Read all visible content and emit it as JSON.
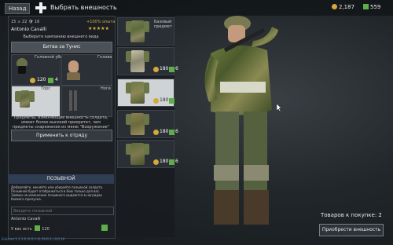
{
  "topbar": {
    "back_label": "Назад",
    "title": "Выбрать внешность",
    "coins": "2,187",
    "gold": "559"
  },
  "profile": {
    "stats": "15 ⚔ 22 🛡 16",
    "exp_bonus": "+100% опыта",
    "name": "Antonio Cavalli",
    "rating": "★★★★★"
  },
  "campaign_select": {
    "prompt": "Выберите кампанию внешнего вида",
    "button_label": "Битва за Тунис"
  },
  "slots": {
    "helmet": {
      "label": "Головной убор",
      "price": "120",
      "count": "4"
    },
    "head": {
      "label": "Голова"
    },
    "torso": {
      "label": "Торс"
    },
    "legs": {
      "label": "Ноги"
    }
  },
  "info_text": "Предметы, изменяющие внешность солдата, имеют более высокий приоритет, чем предметы снаряжения из меню \"Вооружение\"",
  "apply_button": "Применить к отряду",
  "callsign": {
    "header": "ПОЗЫВНОЙ",
    "description": "Добавляйте, меняйте или убирайте позывной солдата. Позывной будет отображаться в бою только для вас. Заявки на изменение позывного выдаются в наградах боевого пропуска.",
    "placeholder": "Введите позывной",
    "owner": "Antonio Cavalli",
    "have_label": "У вас есть",
    "have_count": "120"
  },
  "items": [
    {
      "label": "Базовый предмет",
      "price": "",
      "count": ""
    },
    {
      "label": "",
      "price": "180",
      "count": "6"
    },
    {
      "label": "",
      "price": "180",
      "count": "6"
    },
    {
      "label": "",
      "price": "180",
      "count": "6"
    },
    {
      "label": "",
      "price": "180",
      "count": "6"
    }
  ],
  "cart": {
    "label": "Товаров к покупке: 2",
    "buy_button": "Приобрести внешность"
  },
  "footer_text": "Enlisted 1.1.1.0 (0.0.1.0) 29.6.1 / 0.0.16"
}
